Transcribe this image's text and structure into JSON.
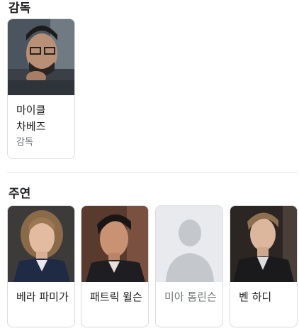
{
  "director_section": {
    "title": "감독",
    "people": [
      {
        "name": "마이클 차베즈",
        "role": "감독"
      }
    ]
  },
  "cast_section": {
    "title": "주연",
    "people": [
      {
        "name": "베라 파미가"
      },
      {
        "name": "패트릭 윌슨"
      },
      {
        "name": "미아 톰린슨",
        "no_photo": true
      },
      {
        "name": "벤 하디"
      }
    ]
  },
  "colors": {
    "text": "#202124",
    "muted": "#70757a",
    "border": "#dadce0",
    "placeholder_bg": "#e8eaed",
    "placeholder_fg": "#c4c7cc"
  },
  "icons": {
    "no_photo": "person-silhouette-icon"
  }
}
